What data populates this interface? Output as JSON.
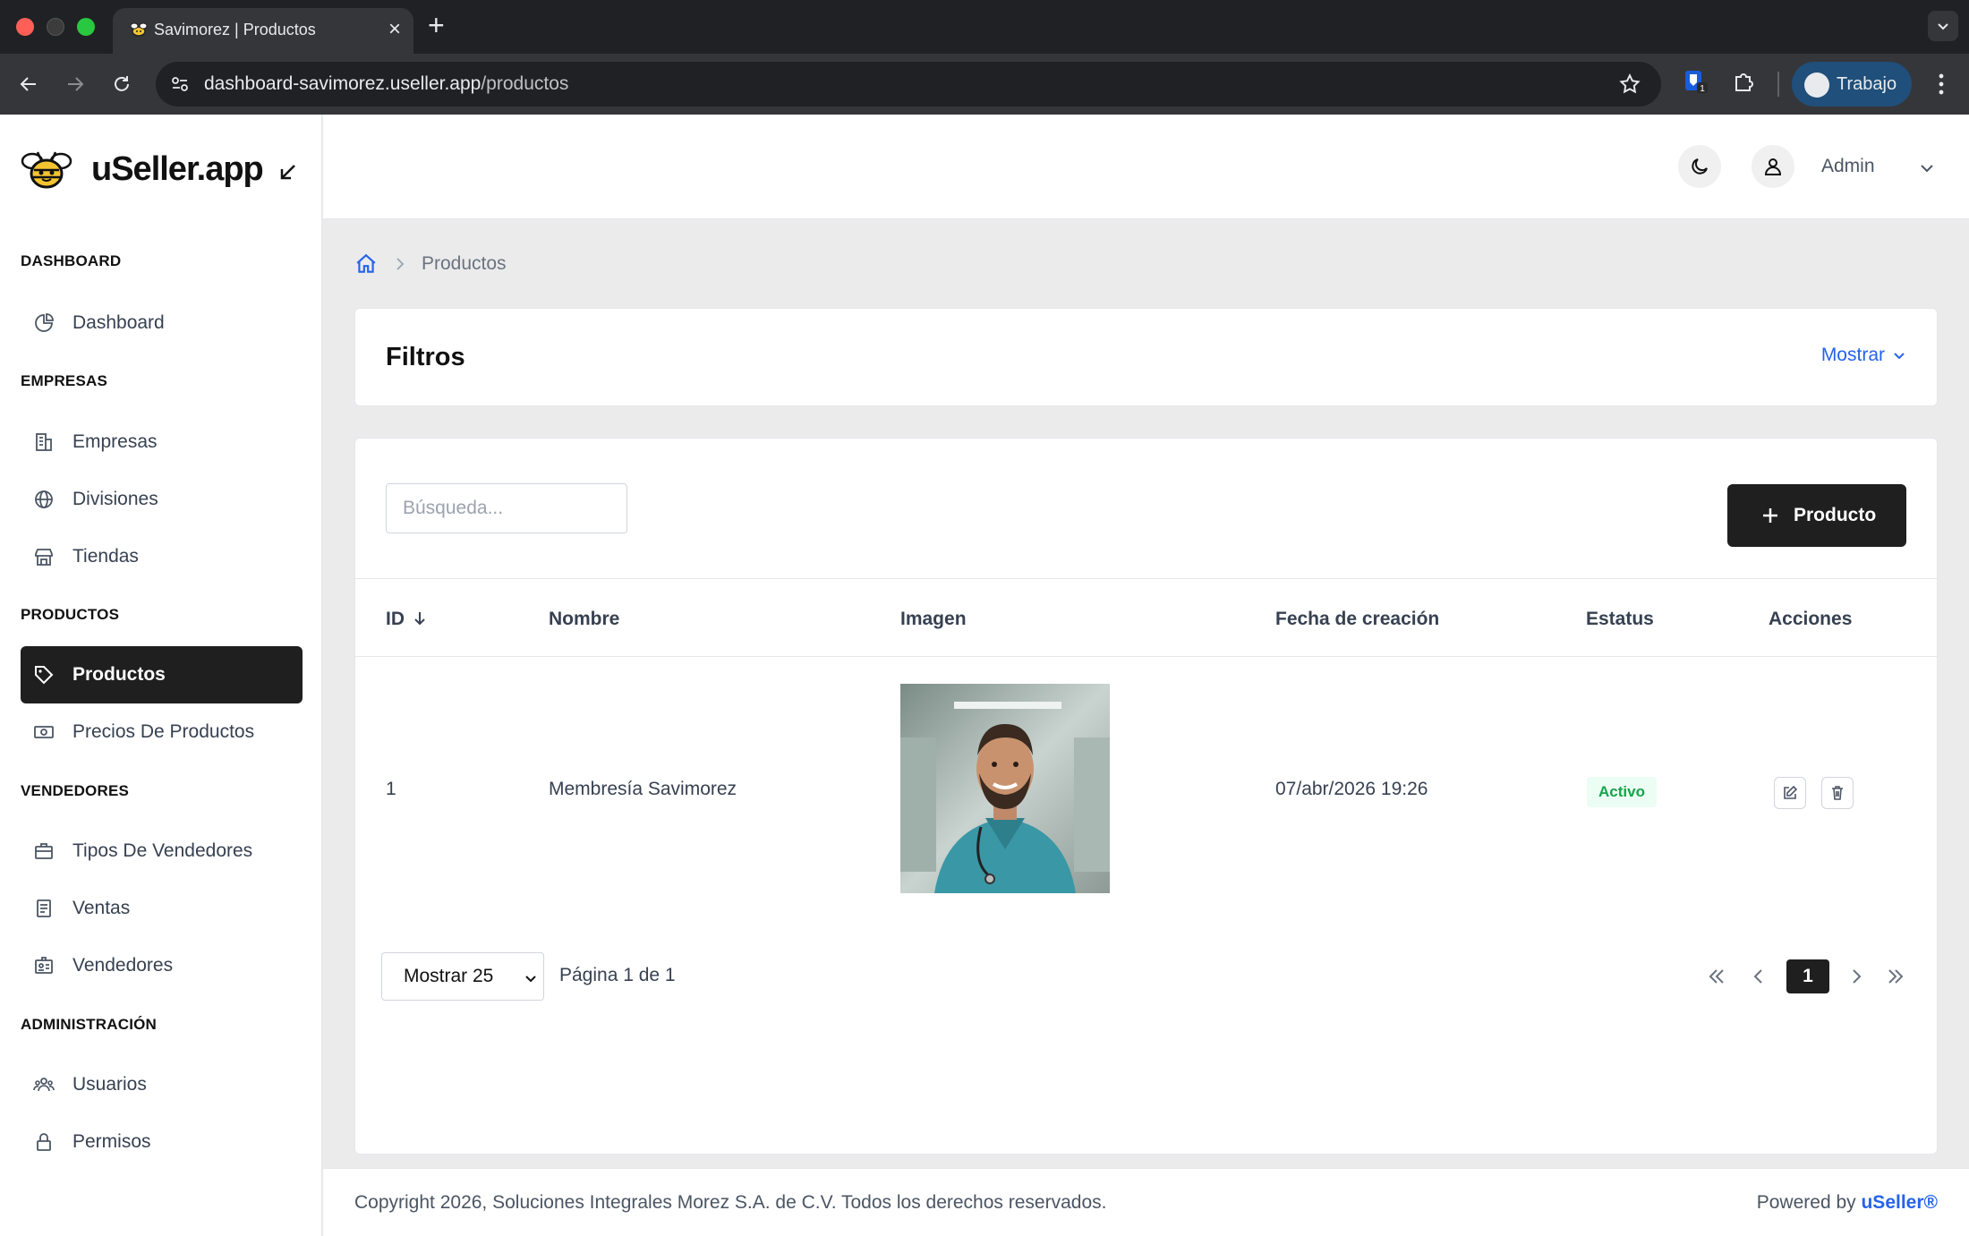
{
  "browser": {
    "tab_title": "Savimorez | Productos",
    "url_host": "dashboard-savimorez.useller.app",
    "url_path": "/productos",
    "profile_label": "Trabajo"
  },
  "sidebar": {
    "brand": "uSeller.app",
    "sections": [
      {
        "title": "DASHBOARD",
        "items": [
          {
            "label": "Dashboard",
            "icon": "pie-chart-icon"
          }
        ]
      },
      {
        "title": "EMPRESAS",
        "items": [
          {
            "label": "Empresas",
            "icon": "building-icon"
          },
          {
            "label": "Divisiones",
            "icon": "globe-icon"
          },
          {
            "label": "Tiendas",
            "icon": "store-icon"
          }
        ]
      },
      {
        "title": "PRODUCTOS",
        "items": [
          {
            "label": "Productos",
            "icon": "tag-icon",
            "active": true
          },
          {
            "label": "Precios De Productos",
            "icon": "banknote-icon"
          }
        ]
      },
      {
        "title": "VENDEDORES",
        "items": [
          {
            "label": "Tipos De Vendedores",
            "icon": "briefcase-icon"
          },
          {
            "label": "Ventas",
            "icon": "receipt-icon"
          },
          {
            "label": "Vendedores",
            "icon": "id-badge-icon"
          }
        ]
      },
      {
        "title": "ADMINISTRACIÓN",
        "items": [
          {
            "label": "Usuarios",
            "icon": "users-icon"
          },
          {
            "label": "Permisos",
            "icon": "lock-icon"
          }
        ]
      }
    ]
  },
  "topbar": {
    "user_label": "Admin"
  },
  "breadcrumb": {
    "current": "Productos"
  },
  "filters": {
    "title": "Filtros",
    "toggle_label": "Mostrar"
  },
  "table": {
    "search_placeholder": "Búsqueda...",
    "add_label": "Producto",
    "columns": [
      "ID",
      "Nombre",
      "Imagen",
      "Fecha de creación",
      "Estatus",
      "Acciones"
    ],
    "rows": [
      {
        "id": "1",
        "nombre": "Membresía Savimorez",
        "fecha": "07/abr/2026 19:26",
        "estatus": "Activo"
      }
    ]
  },
  "pagination": {
    "per_page_label": "Mostrar 25",
    "page_info": "Página 1 de 1",
    "current_page": "1"
  },
  "footer": {
    "copyright": "Copyright 2026, Soluciones Integrales Morez S.A. de C.V. Todos los derechos reservados.",
    "powered_prefix": "Powered by",
    "powered_brand": "uSeller®"
  }
}
